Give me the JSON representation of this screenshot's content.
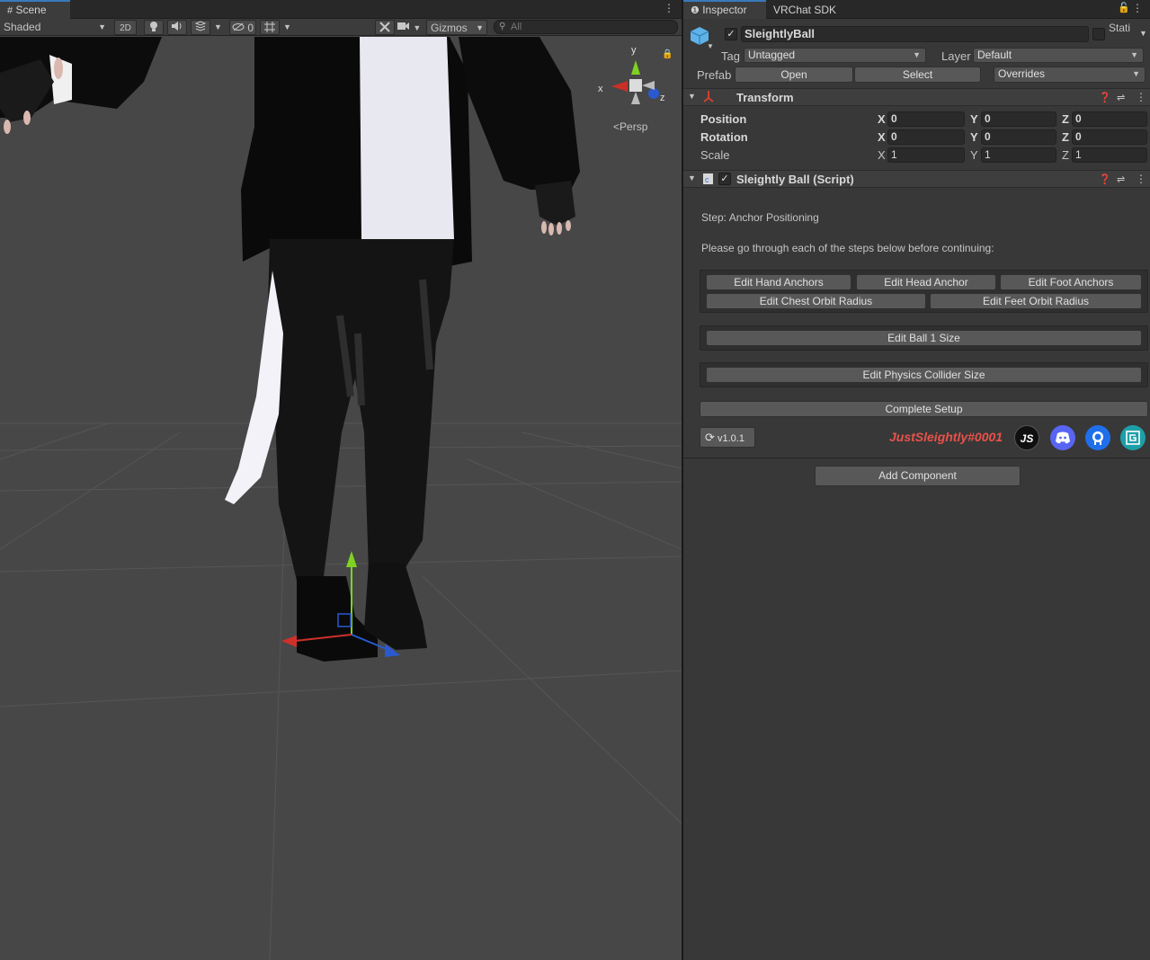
{
  "scene": {
    "tab_label": "Scene",
    "shading_mode": "Shaded",
    "btn_2d": "2D",
    "hidden_count": "0",
    "gizmos_label": "Gizmos",
    "search_placeholder": "All",
    "projection_label": "Persp",
    "axis_x": "x",
    "axis_y": "y",
    "axis_z": "z"
  },
  "inspector": {
    "tabs": [
      "Inspector",
      "VRChat SDK"
    ],
    "object_name": "SleightlyBall",
    "static_label": "Stati",
    "tag_label": "Tag",
    "tag_value": "Untagged",
    "layer_label": "Layer",
    "layer_value": "Default",
    "prefab_label": "Prefab",
    "prefab_open": "Open",
    "prefab_select": "Select",
    "prefab_overrides": "Overrides",
    "transform": {
      "title": "Transform",
      "position_label": "Position",
      "rotation_label": "Rotation",
      "scale_label": "Scale",
      "axis_labels": [
        "X",
        "Y",
        "Z"
      ],
      "position": [
        "0",
        "0",
        "0"
      ],
      "rotation": [
        "0",
        "0",
        "0"
      ],
      "scale": [
        "1",
        "1",
        "1"
      ]
    },
    "script": {
      "title": "Sleightly Ball (Script)",
      "step_text": "Step: Anchor Positioning",
      "instruction": "Please go through each of the steps below before continuing:",
      "buttons": {
        "hand_anchors": "Edit Hand Anchors",
        "head_anchor": "Edit Head Anchor",
        "foot_anchors": "Edit Foot Anchors",
        "chest_orbit": "Edit Chest Orbit Radius",
        "feet_orbit": "Edit Feet Orbit Radius",
        "ball_size": "Edit Ball 1 Size",
        "collider_size": "Edit Physics Collider Size",
        "complete": "Complete Setup"
      },
      "version": "v1.0.1",
      "author_tag": "JustSleightly#0001",
      "author_color": "#e8524a",
      "social_icons": [
        "js-logo-icon",
        "discord-icon",
        "github-icon",
        "website-icon"
      ]
    },
    "add_component": "Add Component"
  }
}
